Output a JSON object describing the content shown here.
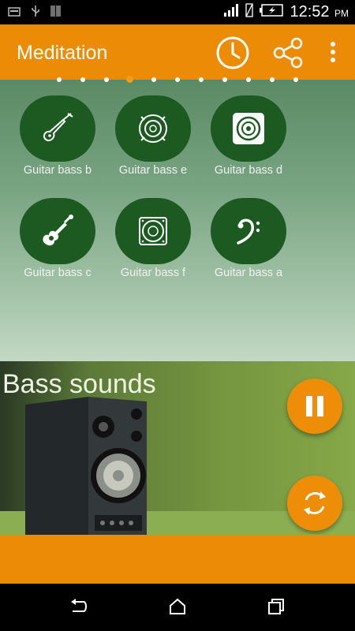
{
  "status_bar": {
    "time": "12:52",
    "ampm": "PM",
    "icons": [
      "notification-icon",
      "usb-icon",
      "barcode-icon",
      "signal-icon",
      "no-sim-icon",
      "battery-charging-icon"
    ]
  },
  "app_bar": {
    "title": "Meditation",
    "actions": [
      "timer-icon",
      "share-icon",
      "more-vert-icon"
    ]
  },
  "page_indicator": {
    "count": 11,
    "active_index": 3
  },
  "sounds": [
    {
      "label": "Guitar bass b",
      "icon": "electric-guitar-icon"
    },
    {
      "label": "Guitar bass e",
      "icon": "speaker-ring-icon"
    },
    {
      "label": "Guitar bass d",
      "icon": "speaker-box-icon"
    },
    {
      "label": "Guitar bass c",
      "icon": "acoustic-guitar-icon"
    },
    {
      "label": "Guitar bass f",
      "icon": "speaker-square-icon"
    },
    {
      "label": "Guitar bass a",
      "icon": "bass-clef-icon"
    }
  ],
  "banner": {
    "title": "Bass sounds",
    "image": "speaker-cabinet-image"
  },
  "controls": {
    "pause": "pause-icon",
    "loop": "loop-icon"
  },
  "nav_bar": [
    "back-icon",
    "home-icon",
    "recents-icon"
  ],
  "colors": {
    "accent": "#ec8c06",
    "tile": "#1c5a22"
  }
}
